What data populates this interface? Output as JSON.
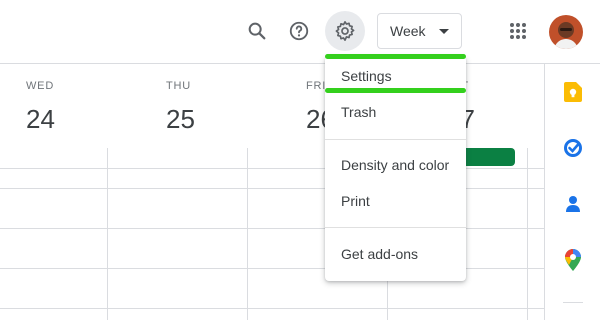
{
  "header": {
    "search_icon": "search-icon",
    "help_icon": "help-icon",
    "settings_icon": "gear-icon",
    "view_selector_label": "Week",
    "apps_icon": "grid-apps-icon"
  },
  "days": [
    {
      "dow": "WED",
      "num": "24"
    },
    {
      "dow": "THU",
      "num": "25"
    },
    {
      "dow": "FRI",
      "num": "26"
    },
    {
      "dow": "SAT",
      "num": "27"
    }
  ],
  "menu": {
    "items": [
      {
        "label": "Settings"
      },
      {
        "label": "Trash"
      },
      {
        "label": "Density and color"
      },
      {
        "label": "Print"
      },
      {
        "label": "Get add-ons"
      }
    ]
  },
  "side_panel": {
    "icons": [
      "keep-icon",
      "tasks-icon",
      "contacts-icon",
      "maps-icon"
    ]
  },
  "colors": {
    "highlight": "#34d01d",
    "event": "#0b8043",
    "keep": "#fbbc04",
    "tasks": "#1a73e8",
    "contacts": "#1a73e8"
  }
}
